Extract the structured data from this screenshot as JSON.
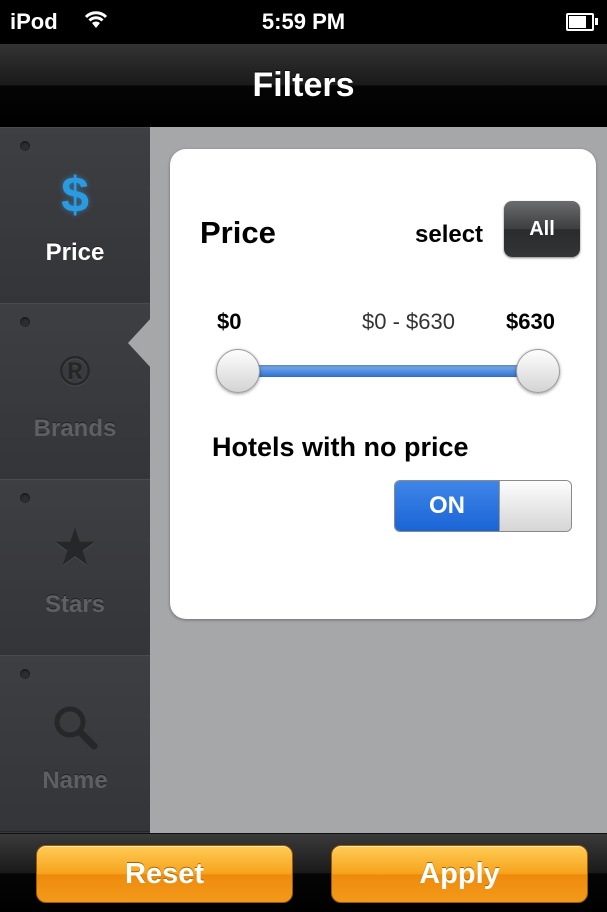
{
  "status_bar": {
    "carrier": "iPod",
    "time": "5:59 PM",
    "wifi_icon": "wifi-icon",
    "battery_icon": "battery-icon"
  },
  "nav": {
    "title": "Filters"
  },
  "sidebar": {
    "items": [
      {
        "label": "Price",
        "icon": "$",
        "icon_name": "dollar-icon",
        "active": true
      },
      {
        "label": "Brands",
        "icon": "®",
        "icon_name": "registered-icon",
        "active": false
      },
      {
        "label": "Stars",
        "icon": "★",
        "icon_name": "star-icon",
        "active": false
      },
      {
        "label": "Name",
        "icon": "⚲",
        "icon_name": "magnifier-icon",
        "active": false
      }
    ]
  },
  "price_panel": {
    "title": "Price",
    "select_label": "select",
    "all_button": "All",
    "min_label": "$0",
    "range_label": "$0 - $630",
    "max_label": "$630",
    "slider": {
      "min": 0,
      "max": 630,
      "low": 0,
      "high": 630
    },
    "no_price_label": "Hotels with no price",
    "toggle_state": "ON"
  },
  "toolbar": {
    "reset_label": "Reset",
    "apply_label": "Apply"
  },
  "colors": {
    "accent_blue": "#2a9be0",
    "toggle_blue": "#1b64d6",
    "button_orange": "#f39a1a",
    "sidebar_bg": "#38393b",
    "content_bg": "#a6a7a9"
  }
}
